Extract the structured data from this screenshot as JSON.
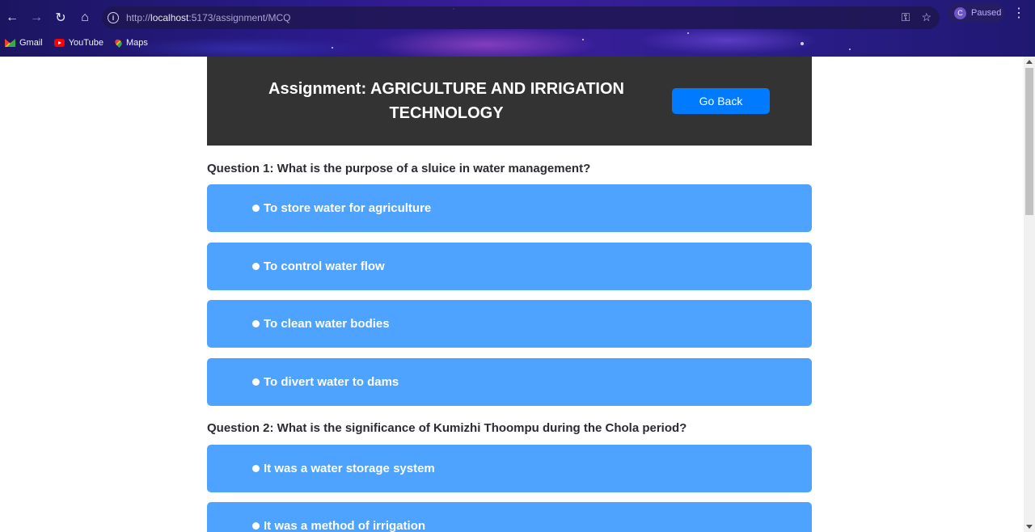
{
  "browser": {
    "url_prefix": "http://",
    "url_host": "localhost",
    "url_rest": ":5173/assignment/MCQ",
    "profile_initial": "C",
    "profile_status": "Paused",
    "bookmarks": [
      {
        "label": "Gmail",
        "icon": "gmail-icon"
      },
      {
        "label": "YouTube",
        "icon": "youtube-icon"
      },
      {
        "label": "Maps",
        "icon": "maps-icon"
      }
    ]
  },
  "header": {
    "title": "Assignment: AGRICULTURE AND IRRIGATION TECHNOLOGY",
    "go_back_label": "Go Back"
  },
  "questions": [
    {
      "text": "Question 1: What is the purpose of a sluice in water management?",
      "options": [
        "To store water for agriculture",
        "To control water flow",
        "To clean water bodies",
        "To divert water to dams"
      ]
    },
    {
      "text": "Question 2: What is the significance of Kumizhi Thoompu during the Chola period?",
      "options": [
        "It was a water storage system",
        "It was a method of irrigation"
      ]
    }
  ],
  "colors": {
    "header_bg": "#333333",
    "option_bg": "#4da3ff",
    "button_bg": "#007bff"
  }
}
